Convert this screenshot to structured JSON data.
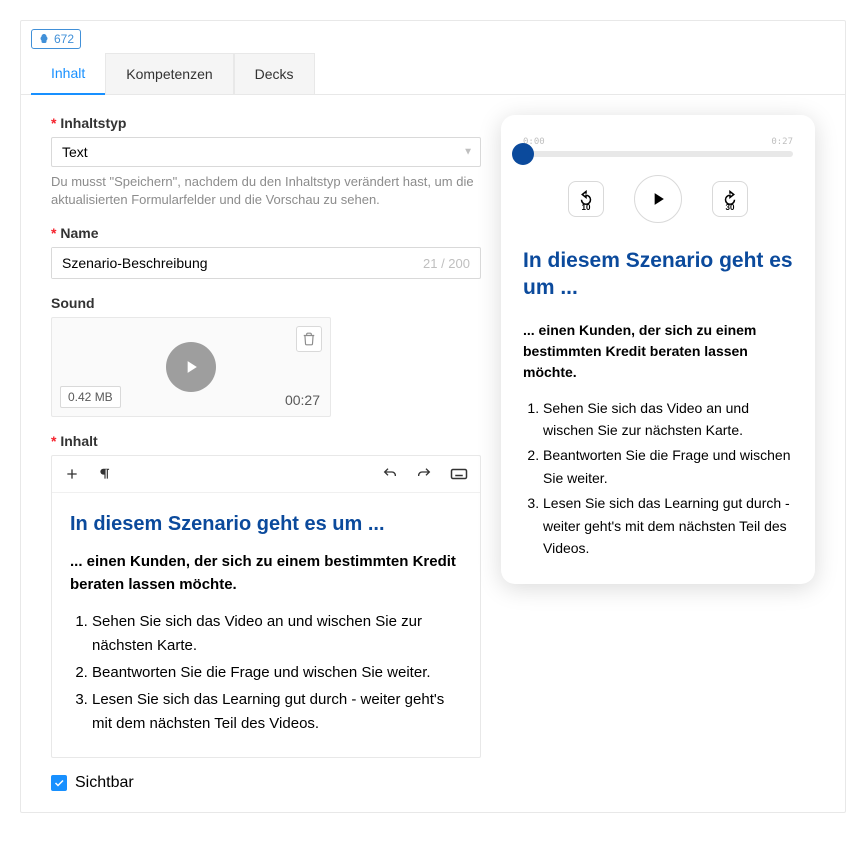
{
  "badge": {
    "id": "672"
  },
  "tabs": [
    "Inhalt",
    "Kompetenzen",
    "Decks"
  ],
  "form": {
    "contentTypeLabel": "Inhaltstyp",
    "contentTypeValue": "Text",
    "contentTypeHelp": "Du musst \"Speichern\", nachdem du den Inhaltstyp verändert hast, um die aktualisierten Formularfelder und die Vorschau zu sehen.",
    "nameLabel": "Name",
    "nameValue": "Szenario-Beschreibung",
    "nameCount": "21 / 200",
    "soundLabel": "Sound",
    "soundSize": "0.42 MB",
    "soundDuration": "00:27",
    "contentLabel": "Inhalt",
    "visibleLabel": "Sichtbar"
  },
  "content": {
    "heading": "In diesem Szenario geht es um ...",
    "lead": "... einen Kunden, der sich zu einem bestimmten Kredit beraten lassen möchte.",
    "items": [
      "Sehen Sie sich das Video an und wischen Sie zur nächsten Karte.",
      "Beantworten Sie die Frage und wischen Sie weiter.",
      "Lesen Sie sich das Learning gut durch - weiter geht's mit dem nächsten Teil des Videos."
    ]
  },
  "player": {
    "start": "0:00",
    "end": "0:27",
    "back": "10",
    "forward": "30"
  }
}
